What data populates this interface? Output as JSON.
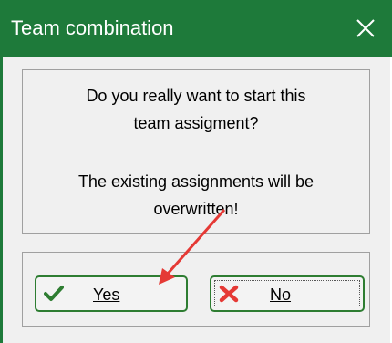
{
  "window": {
    "title": "Team combination",
    "close_icon": "close-icon",
    "titlebar_color": "#1e7a3a"
  },
  "message": {
    "line1": "Do you really want to start this",
    "line2": "team assigment?",
    "line3": "The existing assignments will be",
    "line4": "overwritten!"
  },
  "buttons": {
    "yes": {
      "label": "Yes",
      "icon": "checkmark-icon",
      "icon_color": "#2e7d32"
    },
    "no": {
      "label": "No",
      "icon": "x-cross-icon",
      "icon_color": "#e53935"
    }
  },
  "annotation": {
    "arrow_icon": "red-arrow-annotation",
    "color": "#e53935"
  }
}
